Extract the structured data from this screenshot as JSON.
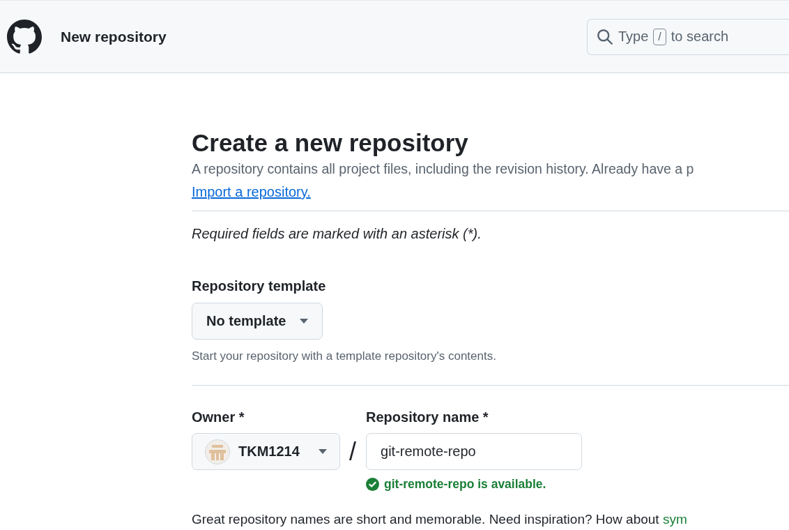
{
  "header": {
    "title": "New repository",
    "search": {
      "prefix": "Type",
      "key": "/",
      "suffix": "to search"
    }
  },
  "page": {
    "heading": "Create a new repository",
    "description": "A repository contains all project files, including the revision history. Already have a p",
    "import_link": "Import a repository.",
    "required_note": "Required fields are marked with an asterisk (*)."
  },
  "template": {
    "label": "Repository template",
    "value": "No template",
    "hint": "Start your repository with a template repository's contents."
  },
  "owner": {
    "label": "Owner *",
    "value": "TKM1214"
  },
  "separator": "/",
  "repository_name": {
    "label": "Repository name *",
    "value": "git-remote-repo",
    "status": "git-remote-repo is available.",
    "available": true
  },
  "inspiration": {
    "text": "Great repository names are short and memorable. Need inspiration? How about",
    "link": "sym"
  }
}
